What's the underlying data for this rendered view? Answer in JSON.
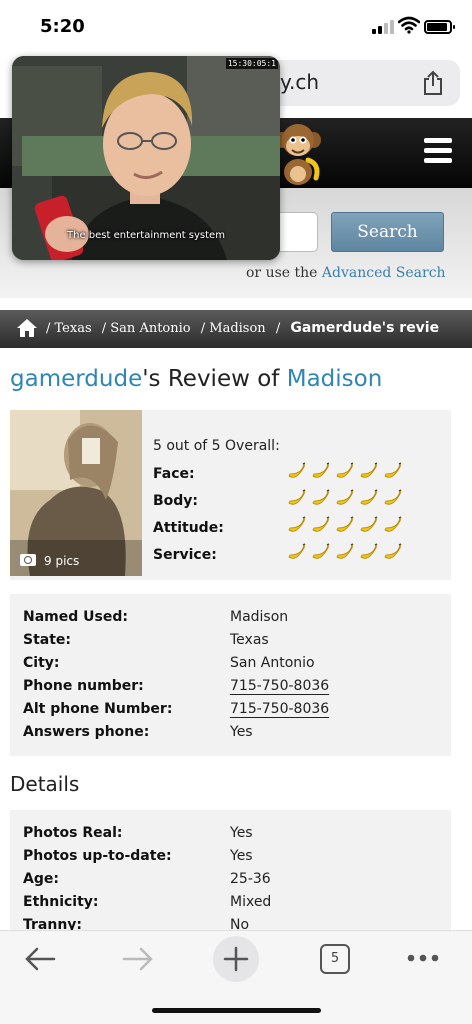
{
  "status_bar": {
    "time": "5:20"
  },
  "browser": {
    "url_partial": "y.ch",
    "tab_count": "5"
  },
  "video": {
    "timestamp": "15:30:05:1",
    "caption": "The best entertainment system"
  },
  "search": {
    "button_label": "Search",
    "prefix": "or use the",
    "advanced_link": "Advanced Search"
  },
  "breadcrumb": {
    "items": [
      "/ Texas",
      "/ San Antonio",
      "/ Madison",
      "/"
    ],
    "current": "Gamerdude's revie"
  },
  "page_title": {
    "user": "gamerdude",
    "middle": "'s Review of",
    "subject": "Madison"
  },
  "review": {
    "pics_label": "9 pics",
    "overall": "5 out of 5 Overall:",
    "ratings": [
      {
        "label": "Face:",
        "score": 5
      },
      {
        "label": "Body:",
        "score": 5
      },
      {
        "label": "Attitude:",
        "score": 5
      },
      {
        "label": "Service:",
        "score": 5
      }
    ]
  },
  "info": [
    {
      "label": "Named Used:",
      "value": "Madison"
    },
    {
      "label": "State:",
      "value": "Texas"
    },
    {
      "label": "City:",
      "value": "San Antonio"
    },
    {
      "label": "Phone number:",
      "value": "715-750-8036"
    },
    {
      "label": "Alt phone Number:",
      "value": "715-750-8036"
    },
    {
      "label": "Answers phone:",
      "value": "Yes"
    }
  ],
  "details_heading": "Details",
  "details": [
    {
      "label": "Photos Real:",
      "value": "Yes"
    },
    {
      "label": "Photos up-to-date:",
      "value": "Yes"
    },
    {
      "label": "Age:",
      "value": "25-36"
    },
    {
      "label": "Ethnicity:",
      "value": "Mixed"
    },
    {
      "label": "Tranny:",
      "value": "No"
    }
  ],
  "colors": {
    "link": "#2f86b5",
    "search_button": "#6f94ae",
    "banana": "#f2c417"
  }
}
